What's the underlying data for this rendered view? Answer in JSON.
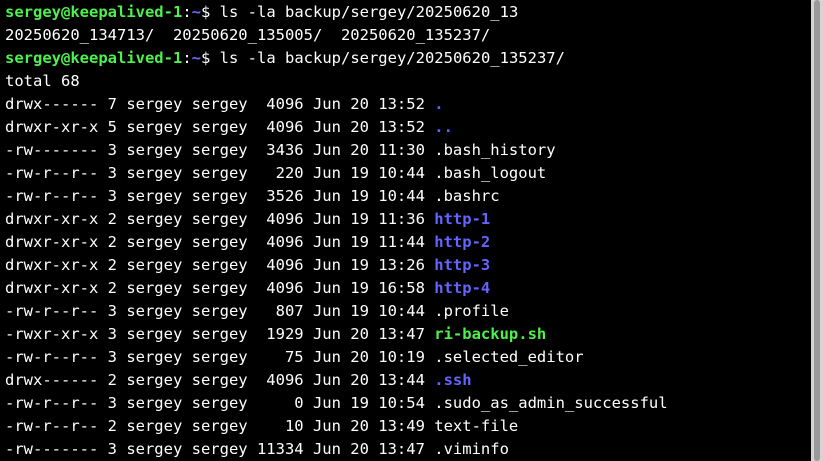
{
  "prompt": {
    "user_host": "sergey@keepalived-1",
    "sep": ":",
    "path": "~",
    "dollar": "$ "
  },
  "commands": [
    "ls -la backup/sergey/20250620_13",
    "ls -la backup/sergey/20250620_135237/"
  ],
  "completion_output": "20250620_134713/  20250620_135005/  20250620_135237/",
  "total_line": "total 68",
  "colors": {
    "background": "#000000",
    "text": "#ffffff",
    "prompt_user": "#4ef04e",
    "directory": "#6464ff",
    "executable": "#4ef04e"
  },
  "listing": [
    {
      "meta": "drwx------ 7 sergey sergey  4096 Jun 20 13:52 ",
      "name": ".",
      "type": "dir"
    },
    {
      "meta": "drwxr-xr-x 5 sergey sergey  4096 Jun 20 13:52 ",
      "name": "..",
      "type": "dir"
    },
    {
      "meta": "-rw------- 3 sergey sergey  3436 Jun 20 11:30 ",
      "name": ".bash_history",
      "type": "file"
    },
    {
      "meta": "-rw-r--r-- 3 sergey sergey   220 Jun 19 10:44 ",
      "name": ".bash_logout",
      "type": "file"
    },
    {
      "meta": "-rw-r--r-- 3 sergey sergey  3526 Jun 19 10:44 ",
      "name": ".bashrc",
      "type": "file"
    },
    {
      "meta": "drwxr-xr-x 2 sergey sergey  4096 Jun 19 11:36 ",
      "name": "http-1",
      "type": "dir"
    },
    {
      "meta": "drwxr-xr-x 2 sergey sergey  4096 Jun 19 11:44 ",
      "name": "http-2",
      "type": "dir"
    },
    {
      "meta": "drwxr-xr-x 2 sergey sergey  4096 Jun 19 13:26 ",
      "name": "http-3",
      "type": "dir"
    },
    {
      "meta": "drwxr-xr-x 2 sergey sergey  4096 Jun 19 16:58 ",
      "name": "http-4",
      "type": "dir"
    },
    {
      "meta": "-rw-r--r-- 3 sergey sergey   807 Jun 19 10:44 ",
      "name": ".profile",
      "type": "file"
    },
    {
      "meta": "-rwxr-xr-x 3 sergey sergey  1929 Jun 20 13:47 ",
      "name": "ri-backup.sh",
      "type": "exec"
    },
    {
      "meta": "-rw-r--r-- 3 sergey sergey    75 Jun 20 10:19 ",
      "name": ".selected_editor",
      "type": "file"
    },
    {
      "meta": "drwx------ 2 sergey sergey  4096 Jun 20 13:44 ",
      "name": ".ssh",
      "type": "dir"
    },
    {
      "meta": "-rw-r--r-- 3 sergey sergey     0 Jun 19 10:54 ",
      "name": ".sudo_as_admin_successful",
      "type": "file"
    },
    {
      "meta": "-rw-r--r-- 2 sergey sergey    10 Jun 20 13:49 ",
      "name": "text-file",
      "type": "file"
    },
    {
      "meta": "-rw------- 3 sergey sergey 11334 Jun 20 13:47 ",
      "name": ".viminfo",
      "type": "file"
    }
  ]
}
